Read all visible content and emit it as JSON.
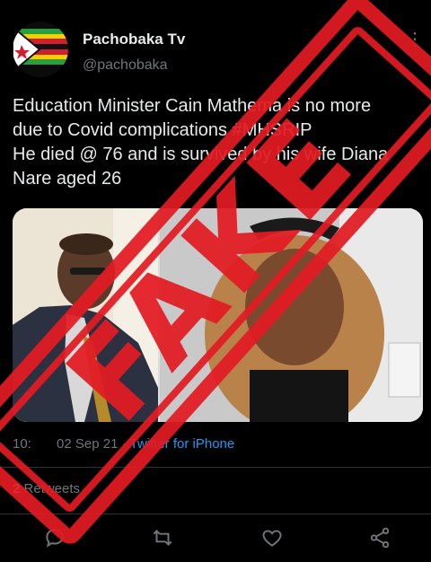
{
  "author": {
    "display_name": "Pachobaka Tv",
    "handle": "@pachobaka"
  },
  "tweet": {
    "lines": [
      "Education Minister Cain Mathema is no more",
      "due to Covid complications #MHSRIP",
      "He died @ 76 and is survived by his wife  Diana",
      "Nare aged 26"
    ]
  },
  "meta": {
    "time": "10:",
    "date": "02 Sep 21",
    "separator": " · ",
    "source": "Twitter for iPhone"
  },
  "stats": {
    "retweets_count": "2",
    "retweets_label": " Retweets"
  },
  "stamp": {
    "text": "FAKE",
    "color": "#e31b23"
  },
  "icons": [
    "more-icon",
    "reply-icon",
    "retweet-icon",
    "like-icon",
    "share-icon"
  ]
}
